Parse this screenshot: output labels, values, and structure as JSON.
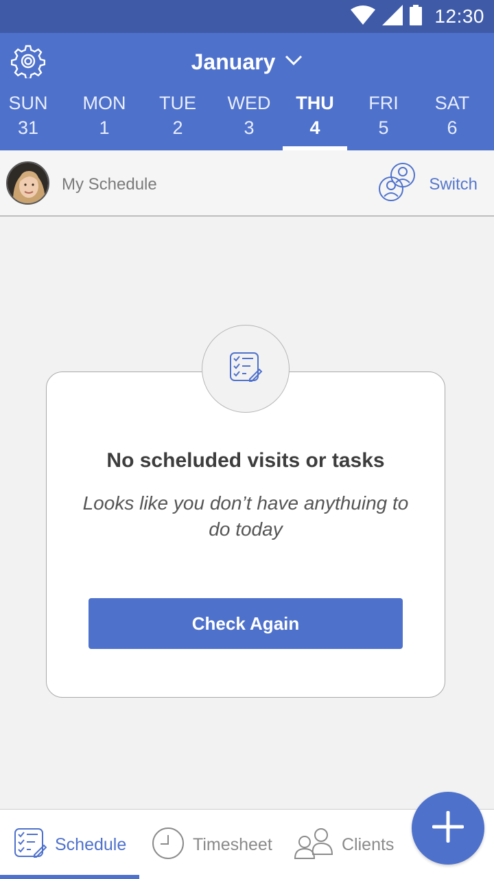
{
  "status_bar": {
    "time": "12:30"
  },
  "header": {
    "month": "January",
    "days": [
      {
        "name": "SUN",
        "date": "31"
      },
      {
        "name": "MON",
        "date": "1"
      },
      {
        "name": "TUE",
        "date": "2"
      },
      {
        "name": "WED",
        "date": "3"
      },
      {
        "name": "THU",
        "date": "4",
        "selected": true
      },
      {
        "name": "FRI",
        "date": "5"
      },
      {
        "name": "SAT",
        "date": "6"
      }
    ]
  },
  "subheader": {
    "schedule_label": "My Schedule",
    "switch_label": "Switch"
  },
  "empty_state": {
    "icon": "checklist-edit-icon",
    "title": "No scheluded visits or tasks",
    "subtitle": "Looks like you don’t have anythuing to do today",
    "button_label": "Check Again"
  },
  "bottom_nav": {
    "items": [
      {
        "label": "Schedule",
        "icon": "checklist-edit-icon",
        "active": true
      },
      {
        "label": "Timesheet",
        "icon": "clock-icon"
      },
      {
        "label": "Clients",
        "icon": "people-icon"
      }
    ]
  },
  "colors": {
    "primary": "#4e71cc",
    "status_bar": "#3f5ba8",
    "background": "#f2f2f2"
  }
}
